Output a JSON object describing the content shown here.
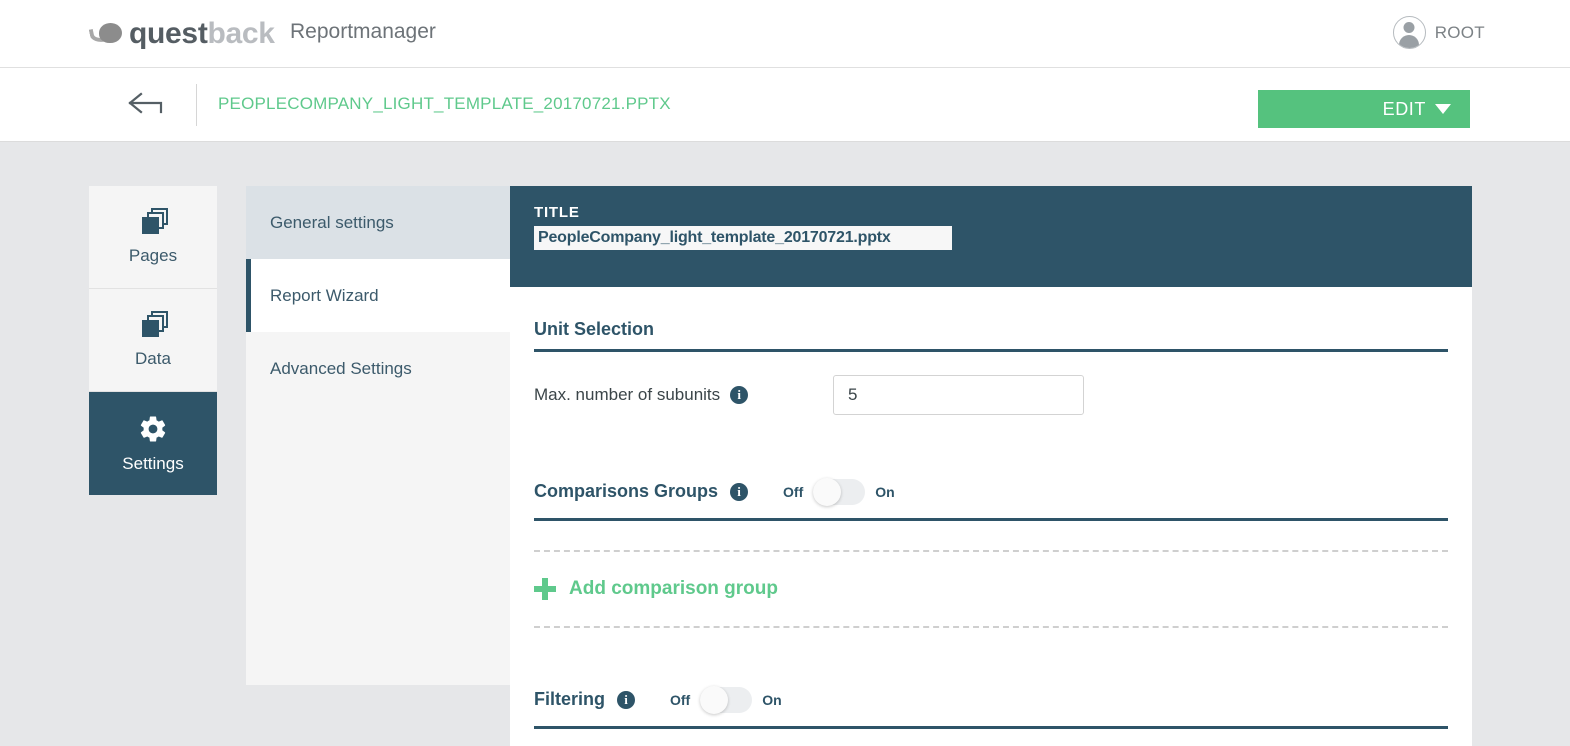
{
  "header": {
    "brand_first": "quest",
    "brand_second": "back",
    "app_title": "Reportmanager",
    "user_name": "ROOT",
    "avatar_icon": "user-avatar-icon",
    "logo_icon": "questback-speech-bubble-logo"
  },
  "subheader": {
    "back_icon": "back-arrow-icon",
    "document_name": "PEOPLECOMPANY_LIGHT_TEMPLATE_20170721.PPTX",
    "edit_label": "EDIT",
    "edit_caret_icon": "chevron-down-icon",
    "edit_color": "#55c27e"
  },
  "leftnav": {
    "items": [
      {
        "label": "Pages",
        "icon": "stacked-pages-icon",
        "active": false
      },
      {
        "label": "Data",
        "icon": "stacked-data-icon",
        "active": false
      },
      {
        "label": "Settings",
        "icon": "gear-icon",
        "active": true
      }
    ]
  },
  "subnav": {
    "items": [
      {
        "label": "General settings",
        "state": "hovered"
      },
      {
        "label": "Report Wizard",
        "state": "selected"
      },
      {
        "label": "Advanced Settings",
        "state": "normal"
      }
    ]
  },
  "panel": {
    "title_label": "TITLE",
    "title_value": "PeopleCompany_light_template_20170721.pptx",
    "title_placeholder": "Report title",
    "accent_color": "#2e5468",
    "unit_selection": {
      "heading": "Unit Selection",
      "field_label": "Max. number of subunits",
      "field_info_icon": "info-icon",
      "field_value": "5",
      "field_placeholder": ""
    },
    "comparisons": {
      "heading": "Comparisons Groups",
      "info_icon": "info-icon",
      "off_label": "Off",
      "on_label": "On",
      "state": "off",
      "add_label": "Add comparison group",
      "add_icon": "plus-icon"
    },
    "filtering": {
      "heading": "Filtering",
      "info_icon": "info-icon",
      "off_label": "Off",
      "on_label": "On",
      "state": "off"
    }
  }
}
